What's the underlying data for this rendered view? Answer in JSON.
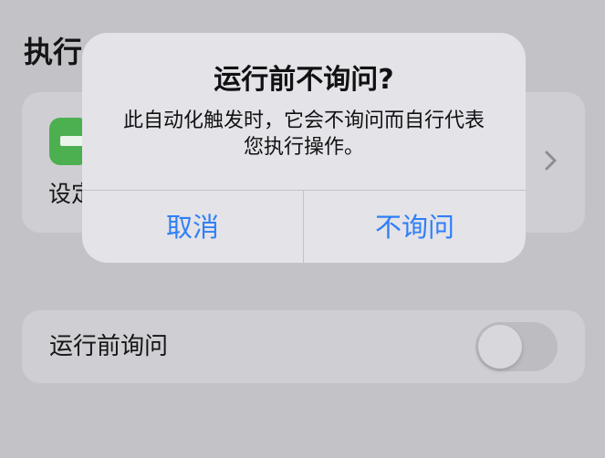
{
  "section": {
    "title": "执行"
  },
  "action": {
    "label": "设定"
  },
  "settings": {
    "ask_before_running_label": "运行前询问",
    "ask_before_running_enabled": false
  },
  "alert": {
    "title": "运行前不询问?",
    "message": "此自动化触发时，它会不询问而自行代表您执行操作。",
    "cancel_label": "取消",
    "confirm_label": "不询问"
  },
  "icons": {
    "action_icon": "app-action-icon",
    "chevron": "chevron-right-icon"
  },
  "colors": {
    "accent_blue": "#2f7ff7",
    "action_green": "#4caf50"
  }
}
